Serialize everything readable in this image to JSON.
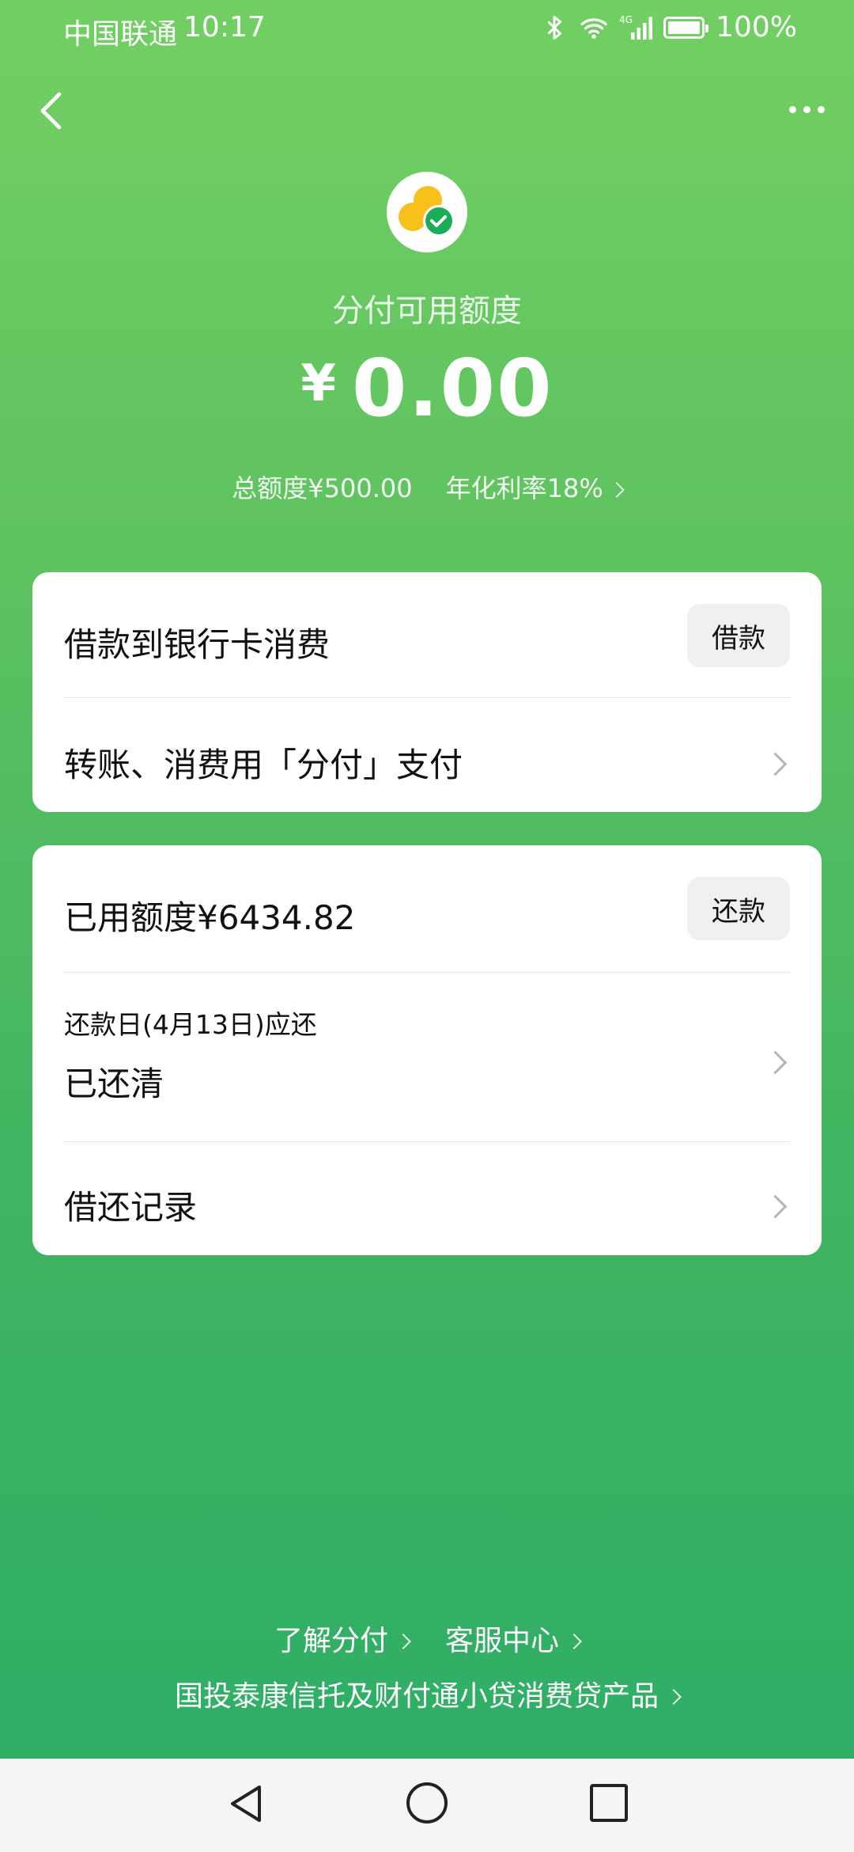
{
  "status_bar": {
    "carrier": "中国联通",
    "time": "10:17",
    "network": "4G",
    "battery_text": "100%",
    "battery_level": 1.0
  },
  "header": {
    "title": "分付可用额度",
    "currency_symbol": "¥",
    "available_amount": "0.00",
    "total_limit": "总额度¥500.00",
    "annual_rate": "年化利率18%"
  },
  "card_borrow": {
    "borrow_row_label": "借款到银行卡消费",
    "borrow_button": "借款",
    "pay_row_label": "转账、消费用「分付」支付"
  },
  "card_repay": {
    "used_limit_label": "已用额度¥6434.82",
    "repay_button": "还款",
    "due_date_label": "还款日(4月13日)应还",
    "due_status": "已还清",
    "records_label": "借还记录"
  },
  "footer": {
    "link_learn": "了解分付",
    "link_service": "客服中心",
    "product_note": "国投泰康信托及财付通小贷消费贷产品"
  },
  "colors": {
    "bg_top": "#72cf63",
    "bg_bottom": "#2fae66",
    "card_bg": "#ffffff",
    "button_bg": "#f0f0f0",
    "logo_yellow": "#f7c01a",
    "logo_green": "#1aad57"
  },
  "icons": {
    "back": "chevron-left-icon",
    "more": "more-dots-icon",
    "logo": "fenfu-logo-icon",
    "bluetooth": "bluetooth-icon",
    "wifi": "wifi-icon",
    "signal": "signal-icon",
    "battery": "battery-icon"
  }
}
